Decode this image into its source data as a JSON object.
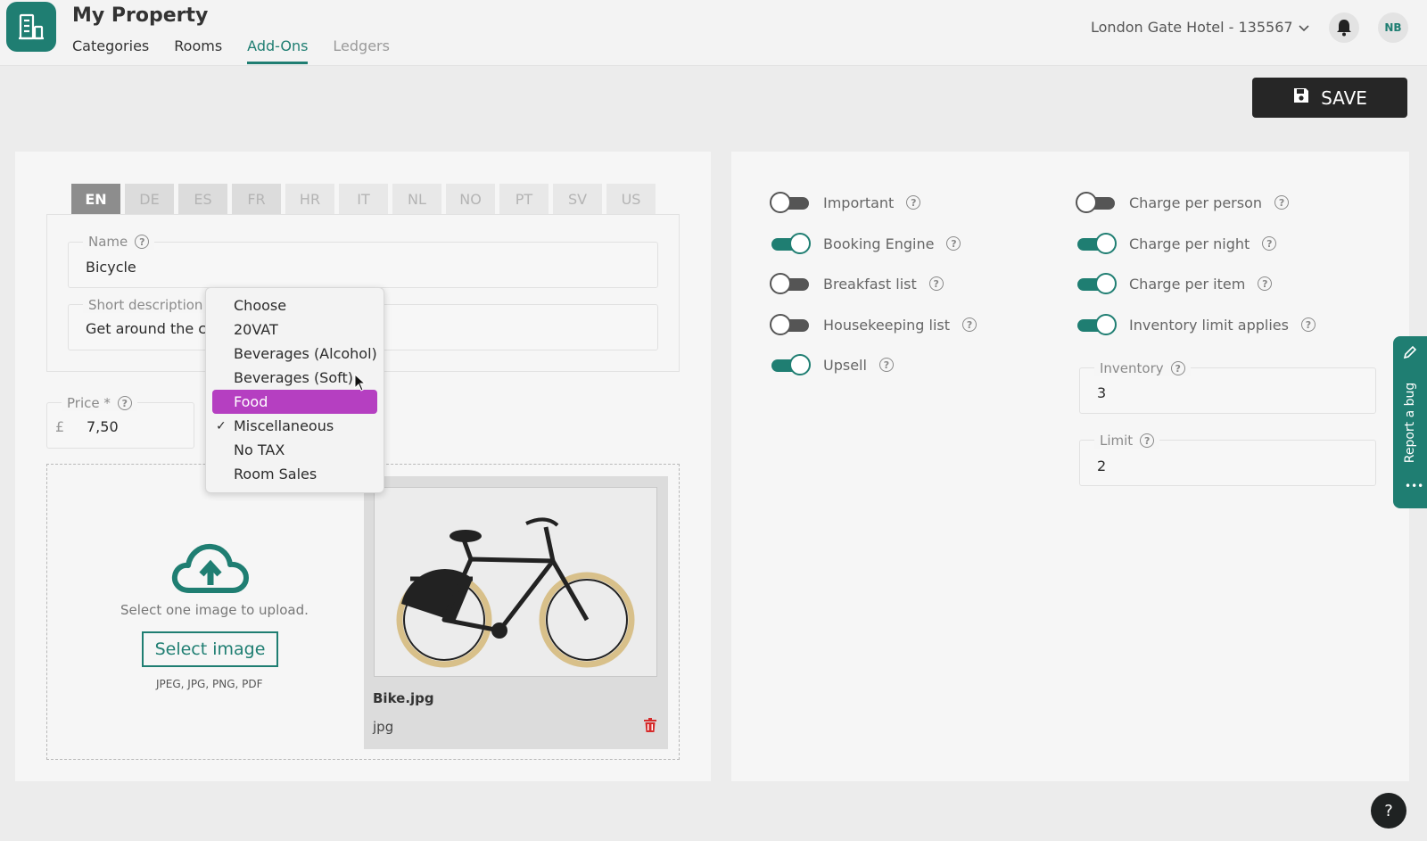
{
  "app": {
    "title": "My Property"
  },
  "nav": {
    "tabs": [
      {
        "label": "Categories"
      },
      {
        "label": "Rooms"
      },
      {
        "label": "Add-Ons"
      },
      {
        "label": "Ledgers"
      }
    ],
    "active_tab": "Add-Ons"
  },
  "header": {
    "hotel_selector": "London Gate Hotel - 135567",
    "avatar_initials": "NB"
  },
  "toolbar": {
    "save_label": "SAVE"
  },
  "languages": [
    "EN",
    "DE",
    "ES",
    "FR",
    "HR",
    "IT",
    "NL",
    "NO",
    "PT",
    "SV",
    "US"
  ],
  "active_language": "EN",
  "form": {
    "name_label": "Name",
    "name_value": "Bicycle",
    "short_desc_label": "Short description",
    "short_desc_value": "Get around the city",
    "price_label": "Price *",
    "price_currency": "£",
    "price_value": "7,50"
  },
  "tax_dropdown": {
    "options": [
      "Choose",
      "20VAT",
      "Beverages (Alcohol)",
      "Beverages (Soft)",
      "Food",
      "Miscellaneous",
      "No TAX",
      "Room Sales"
    ],
    "highlighted": "Food",
    "checked": "Miscellaneous"
  },
  "upload": {
    "prompt": "Select one image to upload.",
    "button_label": "Select image",
    "formats": "JPEG, JPG, PNG, PDF",
    "file_name": "Bike.jpg",
    "file_ext": "jpg"
  },
  "toggles": {
    "important": {
      "label": "Important",
      "on": false
    },
    "booking_engine": {
      "label": "Booking Engine",
      "on": true
    },
    "breakfast_list": {
      "label": "Breakfast list",
      "on": false
    },
    "housekeeping_list": {
      "label": "Housekeeping list",
      "on": false
    },
    "upsell": {
      "label": "Upsell",
      "on": true
    },
    "charge_per_person": {
      "label": "Charge per person",
      "on": false
    },
    "charge_per_night": {
      "label": "Charge per night",
      "on": true
    },
    "charge_per_item": {
      "label": "Charge per item",
      "on": true
    },
    "inventory_limit_applies": {
      "label": "Inventory limit applies",
      "on": true
    }
  },
  "inventory": {
    "label": "Inventory",
    "value": "3"
  },
  "limit": {
    "label": "Limit",
    "value": "2"
  },
  "side": {
    "report_bug_label": "Report a bug"
  },
  "help_fab": "?",
  "colors": {
    "accent": "#1f7e72",
    "highlight": "#b53fc1",
    "dark": "#262626"
  }
}
